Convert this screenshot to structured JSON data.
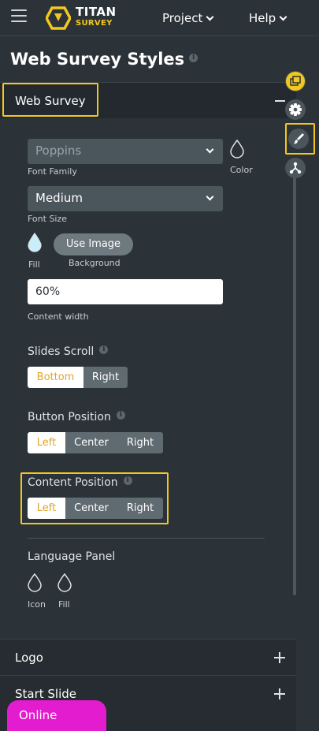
{
  "header": {
    "logo_title": "TITAN",
    "logo_subtitle": "SURVEY",
    "nav": [
      {
        "label": "Project"
      },
      {
        "label": "Help"
      }
    ]
  },
  "page": {
    "title": "Web Survey Styles"
  },
  "web_survey": {
    "label": "Web Survey",
    "font_family_value": "Poppins",
    "font_family_label": "Font Family",
    "color_label": "Color",
    "font_size_value": "Medium",
    "font_size_label": "Font Size",
    "fill_label": "Fill",
    "use_image_label": "Use Image",
    "background_label": "Background",
    "content_width_value": "60%",
    "content_width_label": "Content width",
    "slides_scroll": {
      "label": "Slides Scroll",
      "options": [
        "Bottom",
        "Right"
      ],
      "selected": "Bottom"
    },
    "button_position": {
      "label": "Button Position",
      "options": [
        "Left",
        "Center",
        "Right"
      ],
      "selected": "Left"
    },
    "content_position": {
      "label": "Content Position",
      "options": [
        "Left",
        "Center",
        "Right"
      ],
      "selected": "Left"
    },
    "language_panel": {
      "label": "Language Panel",
      "icon_label": "Icon",
      "fill_label": "Fill"
    }
  },
  "sections": [
    {
      "label": "Logo"
    },
    {
      "label": "Start Slide"
    }
  ],
  "side_rail": [
    {
      "icon": "layers-icon"
    },
    {
      "icon": "gear-icon"
    },
    {
      "icon": "brush-icon"
    },
    {
      "icon": "share-nodes-icon"
    }
  ],
  "status": {
    "label": "Online"
  },
  "colors": {
    "background": "#2b3238",
    "highlight": "#f2c81e",
    "selected_text": "#e0a72a",
    "online": "#e31ccf"
  }
}
